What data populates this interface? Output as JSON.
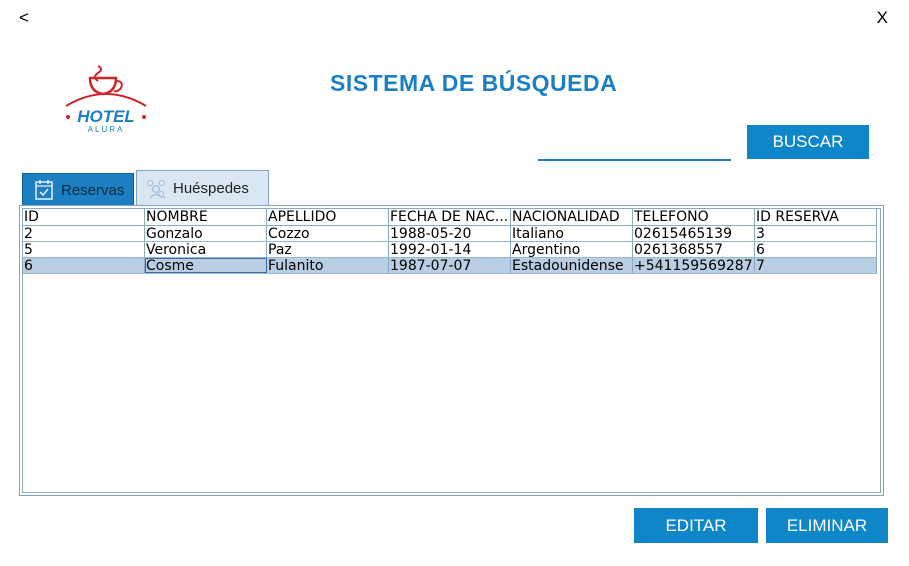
{
  "window": {
    "back_label": "<",
    "close_label": "X"
  },
  "header": {
    "title": "SISTEMA DE BÚSQUEDA",
    "logo_text": "HOTEL",
    "logo_subtext": "ALURA"
  },
  "search": {
    "value": "",
    "button_label": "BUSCAR"
  },
  "tabs": [
    {
      "label": "Reservas",
      "icon": "reservations-icon",
      "active": false
    },
    {
      "label": "Huéspedes",
      "icon": "guests-icon",
      "active": true
    }
  ],
  "table": {
    "columns": [
      "ID",
      "NOMBRE",
      "APELLIDO",
      "FECHA DE NAC...",
      "NACIONALIDAD",
      "TELEFONO",
      "ID RESERVA"
    ],
    "rows": [
      [
        "2",
        "Gonzalo",
        "Cozzo",
        "1988-05-20",
        "Italiano",
        "02615465139",
        "3"
      ],
      [
        "5",
        "Veronica",
        "Paz",
        "1992-01-14",
        "Argentino",
        "0261368557",
        "6"
      ],
      [
        "6",
        "Cosme",
        "Fulanito",
        "1987-07-07",
        "Estadounidense",
        "+541159569287",
        "7"
      ]
    ],
    "selected_row": 2
  },
  "actions": {
    "edit_label": "EDITAR",
    "delete_label": "ELIMINAR"
  },
  "colors": {
    "accent": "#1b7fc2",
    "button": "#0f86c8",
    "logo_red": "#d0232a",
    "selection": "#b9cde3"
  }
}
